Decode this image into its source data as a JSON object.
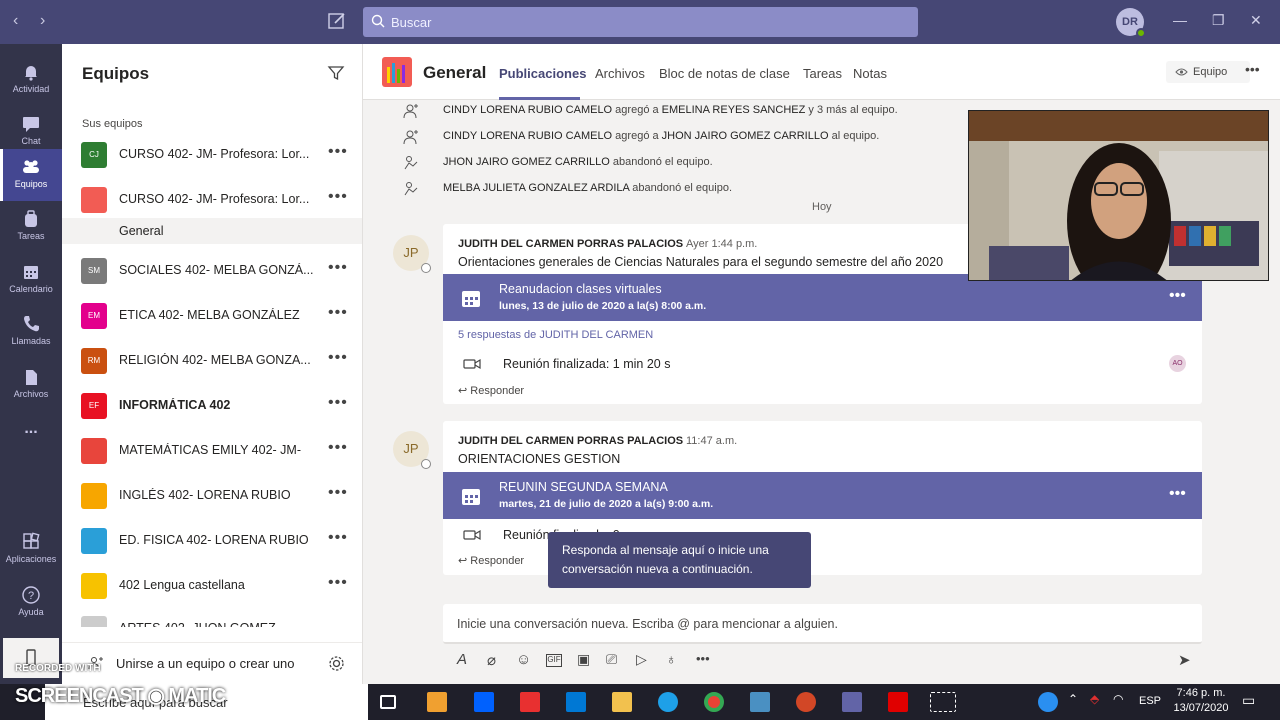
{
  "titlebar": {
    "search_placeholder": "Buscar",
    "avatar_initials": "DR"
  },
  "rail": [
    {
      "label": "Actividad",
      "icon": "bell-icon"
    },
    {
      "label": "Chat",
      "icon": "chat-icon"
    },
    {
      "label": "Equipos",
      "icon": "teams-icon",
      "active": true
    },
    {
      "label": "Tareas",
      "icon": "backpack-icon"
    },
    {
      "label": "Calendario",
      "icon": "calendar-icon"
    },
    {
      "label": "Llamadas",
      "icon": "phone-icon"
    },
    {
      "label": "Archivos",
      "icon": "files-icon"
    },
    {
      "label": "...",
      "icon": "more-icon"
    },
    {
      "label": "Aplicaciones",
      "icon": "apps-icon"
    },
    {
      "label": "Ayuda",
      "icon": "help-icon"
    }
  ],
  "teams_panel": {
    "title": "Equipos",
    "section": "Sus equipos",
    "teams": [
      {
        "name": "CURSO 402- JM- Profesora: Lor...",
        "tile": "CJ",
        "color": "#2e7d32"
      },
      {
        "name": "CURSO 402- JM- Profesora: Lor...",
        "tile": "",
        "color": "#f25c54"
      },
      {
        "name": "SOCIALES 402- MELBA GONZÁ...",
        "tile": "SM",
        "color": "#7a7a7a"
      },
      {
        "name": "ETICA 402- MELBA GONZÁLEZ",
        "tile": "EM",
        "color": "#e3008c"
      },
      {
        "name": "RELIGIÓN 402- MELBA GONZA...",
        "tile": "RM",
        "color": "#ca5010"
      },
      {
        "name": "INFORMÁTICA 402",
        "tile": "EF",
        "color": "#e81123",
        "bold": true
      },
      {
        "name": "MATEMÁTICAS EMILY 402- JM-",
        "tile": "",
        "color": "#e8453c"
      },
      {
        "name": "INGLÉS 402- LORENA RUBIO",
        "tile": "",
        "color": "#f7a600"
      },
      {
        "name": "ED. FISICA 402- LORENA RUBIO",
        "tile": "",
        "color": "#2a9fd8"
      },
      {
        "name": "402 Lengua castellana",
        "tile": "",
        "color": "#f7c200"
      },
      {
        "name": "ARTES 402- JHON GOMEZ",
        "tile": "",
        "color": "#cccccc"
      }
    ],
    "channel": "General",
    "join": "Unirse a un equipo o crear uno"
  },
  "channel_header": {
    "name": "General",
    "tabs": [
      "Publicaciones",
      "Archivos",
      "Bloc de notas de clase",
      "Tareas",
      "Notas"
    ],
    "team_button": "Equipo"
  },
  "system_messages": [
    {
      "icon": "add-member-icon",
      "a": "CINDY LORENA RUBIO CAMELO",
      "v": " agregó a ",
      "b": "EMELINA REYES SANCHEZ",
      "e": " y 3 más al equipo."
    },
    {
      "icon": "add-member-icon",
      "a": "CINDY LORENA RUBIO CAMELO",
      "v": " agregó a ",
      "b": "JHON JAIRO GOMEZ CARRILLO",
      "e": " al equipo."
    },
    {
      "icon": "leave-icon",
      "a": "JHON JAIRO GOMEZ CARRILLO",
      "v": " abandonó el equipo.",
      "b": "",
      "e": ""
    },
    {
      "icon": "leave-icon",
      "a": "MELBA JULIETA GONZALEZ ARDILA",
      "v": " abandonó el equipo.",
      "b": "",
      "e": ""
    }
  ],
  "date_divider": "Hoy",
  "posts": [
    {
      "avatar": "JP",
      "author": "JUDITH DEL CARMEN PORRAS PALACIOS",
      "time": "Ayer 1:44 p.m.",
      "subject": "Orientaciones generales de Ciencias Naturales para el segundo semestre del año 2020",
      "meeting_title": "Reanudacion clases virtuales",
      "meeting_date": "lunes, 13 de julio de 2020 a la(s) 8:00 a.m.",
      "replies": "5 respuestas de JUDITH DEL CARMEN",
      "ended": "Reunión finalizada: 1 min 20 s",
      "participant": "AO",
      "reply": "Responder"
    },
    {
      "avatar": "JP",
      "author": "JUDITH DEL CARMEN PORRAS PALACIOS",
      "time": "11:47 a.m.",
      "subject": "ORIENTACIONES GESTION",
      "meeting_title": "REUNIN SEGUNDA SEMANA",
      "meeting_date": "martes, 21 de julio de 2020 a la(s) 9:00 a.m.",
      "ended": "Reunión finalizada: 0",
      "reply": "Responder"
    }
  ],
  "tooltip": "Responda al mensaje aquí o inicie una conversación nueva a continuación.",
  "compose_placeholder": "Inicie una conversación nueva. Escriba @ para mencionar a alguien.",
  "watermark": {
    "line1": "RECORDED WITH",
    "line2": "SCREENCAST",
    "line3": "MATIC"
  },
  "taskbar": {
    "search": "Escribe aquí para buscar",
    "lang": "ESP",
    "time": "7:46 p. m.",
    "date": "13/07/2020"
  }
}
